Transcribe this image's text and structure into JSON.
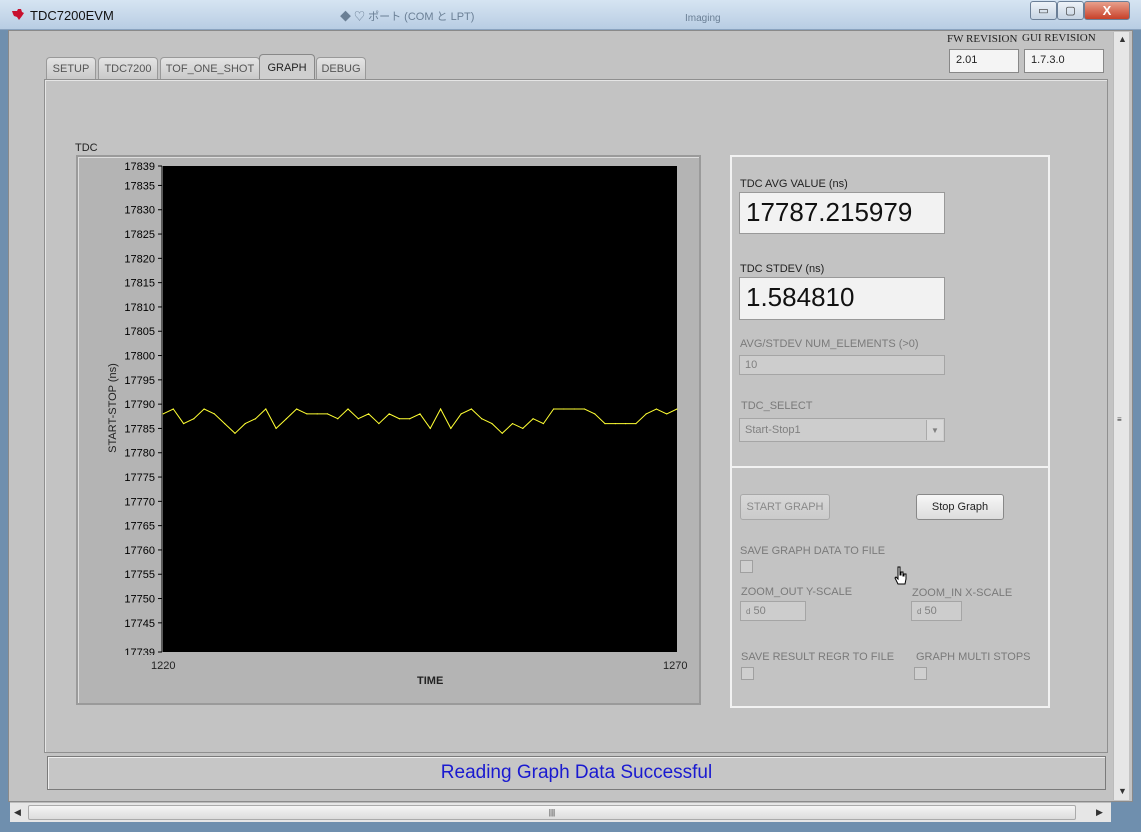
{
  "window": {
    "title": "TDC7200EVM",
    "minimize_glyph": "▭",
    "maximize_glyph": "▢",
    "close_glyph": "X"
  },
  "background_window_text": {
    "line1": "◆ ♡ ポート (COM と LPT)",
    "line2": "Imaging"
  },
  "revision": {
    "fw_label": "FW REVISION",
    "fw_value": "2.01",
    "gui_label": "GUI REVISION",
    "gui_value": "1.7.3.0"
  },
  "tabs": [
    {
      "label": "SETUP",
      "active": false
    },
    {
      "label": "TDC7200",
      "active": false
    },
    {
      "label": "TOF_ONE_SHOT",
      "active": false
    },
    {
      "label": "GRAPH",
      "active": true
    },
    {
      "label": "DEBUG",
      "active": false
    }
  ],
  "graph": {
    "title": "TDC",
    "ylabel": "START-STOP (ns)",
    "xlabel": "TIME",
    "xmin_label": "1220",
    "xmax_label": "1270"
  },
  "chart_data": {
    "type": "line",
    "title": "TDC",
    "xlabel": "TIME",
    "ylabel": "START-STOP (ns)",
    "xlim": [
      1220,
      1270
    ],
    "ylim": [
      17739,
      17839
    ],
    "yticks": [
      17739,
      17745,
      17750,
      17755,
      17760,
      17765,
      17770,
      17775,
      17780,
      17785,
      17790,
      17795,
      17800,
      17805,
      17810,
      17815,
      17820,
      17825,
      17830,
      17835,
      17839
    ],
    "background": "#000000",
    "line_color": "#ffff33",
    "series": [
      {
        "x": [
          1220,
          1221,
          1222,
          1223,
          1224,
          1225,
          1226,
          1227,
          1228,
          1229,
          1230,
          1231,
          1232,
          1233,
          1234,
          1235,
          1236,
          1237,
          1238,
          1239,
          1240,
          1241,
          1242,
          1243,
          1244,
          1245,
          1246,
          1247,
          1248,
          1249,
          1250,
          1251,
          1252,
          1253,
          1254,
          1255,
          1256,
          1257,
          1258,
          1259,
          1260,
          1261,
          1262,
          1263,
          1264,
          1265,
          1266,
          1267,
          1268,
          1269,
          1270
        ],
        "y": [
          17788,
          17789,
          17786,
          17787,
          17789,
          17788,
          17786,
          17784,
          17786,
          17787,
          17789,
          17785,
          17787,
          17789,
          17788,
          17788,
          17788,
          17787,
          17789,
          17787,
          17788,
          17786,
          17788,
          17787,
          17787,
          17788,
          17785,
          17789,
          17785,
          17788,
          17789,
          17787,
          17786,
          17784,
          17786,
          17785,
          17787,
          17786,
          17789,
          17789,
          17789,
          17789,
          17788,
          17786,
          17786,
          17786,
          17786,
          17788,
          17789,
          17788,
          17789
        ]
      }
    ]
  },
  "right_panel": {
    "avg_label": "TDC AVG VALUE (ns)",
    "avg_value": "17787.215979",
    "stdev_label": "TDC STDEV (ns)",
    "stdev_value": "1.584810",
    "num_elements_label": "AVG/STDEV NUM_ELEMENTS (>0)",
    "num_elements_value": "10",
    "tdc_select_label": "TDC_SELECT",
    "tdc_select_value": "Start-Stop1",
    "start_graph_label": "START GRAPH",
    "stop_graph_label": "Stop Graph",
    "save_graph_label": "SAVE GRAPH DATA TO FILE",
    "zoom_out_label": "ZOOM_OUT Y-SCALE",
    "zoom_out_value": "50",
    "zoom_in_label": "ZOOM_IN X-SCALE",
    "zoom_in_value": "50",
    "numeric_prefix": "d",
    "save_result_label": "SAVE RESULT REGR TO FILE",
    "multi_stops_label": "GRAPH MULTI STOPS"
  },
  "status": {
    "text": "Reading Graph Data Successful",
    "color": "#1a1ad0"
  },
  "scrollbar": {
    "grip_glyph": "|||"
  }
}
